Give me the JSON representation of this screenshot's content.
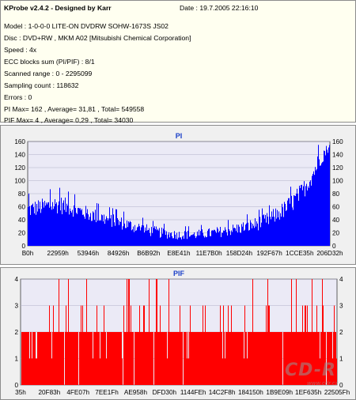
{
  "info": {
    "title": "KProbe v2.4.2 - Designed by Karr",
    "date": "Date : 19.7.2005 22:16:10",
    "lines": [
      "Model : 1-0-0-0 LITE-ON DVDRW SOHW-1673S JS02",
      "Disc : DVD+RW , MKM A02 [Mitsubishi Chemical Corporation]",
      "Speed : 4x",
      "ECC blocks sum (PI/PIF) : 8/1",
      "Scanned range : 0 - 2295099",
      "Sampling count : 118632",
      "Errors : 0",
      "PI Max= 162 , Average= 31,81 , Total= 549558",
      "PIF Max= 4 , Average= 0,29 , Total= 34030"
    ]
  },
  "colors": {
    "pi": "#0000ff",
    "pif": "#ff0000",
    "plot_bg": "#ebeaf6",
    "title": "#1a3fc8"
  },
  "watermark": {
    "logo": "CD-R",
    "url": "www.cdr.cz"
  },
  "chart_data": [
    {
      "type": "bar",
      "title": "PI",
      "xlabel": "",
      "ylabel": "",
      "ylim": [
        0,
        160
      ],
      "y_ticks": [
        0,
        20,
        40,
        60,
        80,
        100,
        120,
        140,
        160
      ],
      "grid": true,
      "x_tick_labels": [
        "B0h",
        "22959h",
        "53946h",
        "84926h",
        "B6B92h",
        "E8E41h",
        "11E7B0h",
        "158D24h",
        "192F67h",
        "1CCE35h",
        "206D32h"
      ],
      "x_range": [
        0,
        2295099
      ],
      "envelope": {
        "x_fraction": [
          0,
          0.05,
          0.1,
          0.15,
          0.2,
          0.25,
          0.3,
          0.35,
          0.4,
          0.45,
          0.5,
          0.55,
          0.6,
          0.65,
          0.7,
          0.75,
          0.8,
          0.85,
          0.88,
          0.91,
          0.94,
          0.97,
          1.0
        ],
        "average": [
          50,
          55,
          58,
          52,
          44,
          38,
          32,
          26,
          20,
          16,
          14,
          14,
          16,
          19,
          23,
          28,
          36,
          50,
          62,
          78,
          100,
          130,
          150
        ],
        "peak": [
          80,
          84,
          90,
          80,
          70,
          62,
          55,
          48,
          40,
          34,
          30,
          30,
          34,
          38,
          44,
          52,
          62,
          80,
          95,
          110,
          130,
          162,
          162
        ]
      }
    },
    {
      "type": "bar",
      "title": "PIF",
      "xlabel": "",
      "ylabel": "",
      "ylim": [
        0,
        4
      ],
      "y_ticks": [
        0,
        1,
        2,
        3,
        4
      ],
      "grid": true,
      "x_tick_labels": [
        "35h",
        "20F83h",
        "4FE07h",
        "7EE1Fh",
        "AE958h",
        "DFD30h",
        "1144FEh",
        "14C2F8h",
        "184150h",
        "1B9E09h",
        "1EF635h",
        "22505Fh"
      ],
      "x_range": [
        0,
        2295099
      ],
      "levels": {
        "typical": 2,
        "max": 4,
        "average": 0.29
      }
    }
  ]
}
